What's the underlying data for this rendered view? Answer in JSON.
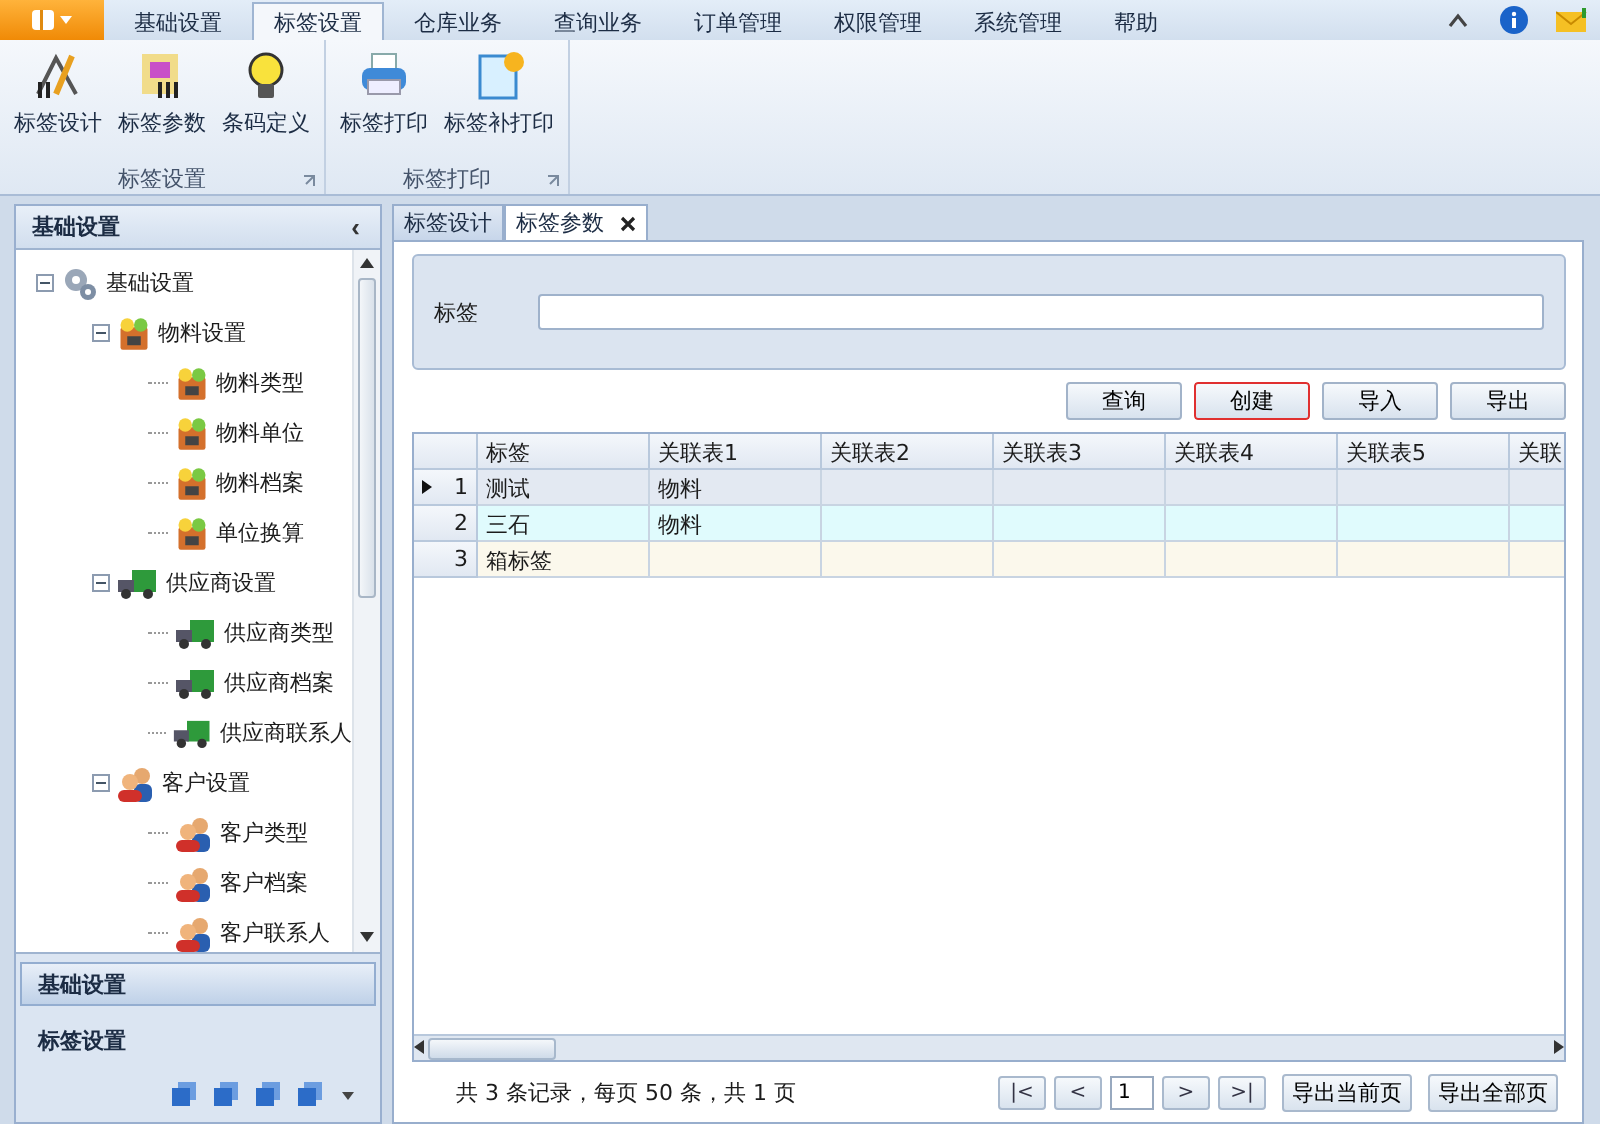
{
  "app_menu": {
    "expanded": false
  },
  "menu_tabs": [
    {
      "label": "基础设置",
      "selected": false
    },
    {
      "label": "标签设置",
      "selected": true
    },
    {
      "label": "仓库业务",
      "selected": false
    },
    {
      "label": "查询业务",
      "selected": false
    },
    {
      "label": "订单管理",
      "selected": false
    },
    {
      "label": "权限管理",
      "selected": false
    },
    {
      "label": "系统管理",
      "selected": false
    },
    {
      "label": "帮助",
      "selected": false
    }
  ],
  "ribbon_groups": [
    {
      "title": "标签设置",
      "buttons": [
        "标签设计",
        "标签参数",
        "条码定义"
      ]
    },
    {
      "title": "标签打印",
      "buttons": [
        "标签打印",
        "标签补打印"
      ]
    }
  ],
  "sidebar": {
    "title": "基础设置",
    "collapse_glyph": "‹",
    "tree": [
      {
        "label": "基础设置",
        "expanded": true,
        "children": [
          {
            "label": "物料设置",
            "expanded": true,
            "children": [
              {
                "label": "物料类型"
              },
              {
                "label": "物料单位"
              },
              {
                "label": "物料档案"
              },
              {
                "label": "单位换算"
              }
            ]
          },
          {
            "label": "供应商设置",
            "expanded": true,
            "children": [
              {
                "label": "供应商类型"
              },
              {
                "label": "供应商档案"
              },
              {
                "label": "供应商联系人"
              }
            ]
          },
          {
            "label": "客户设置",
            "expanded": true,
            "children": [
              {
                "label": "客户类型"
              },
              {
                "label": "客户档案"
              },
              {
                "label": "客户联系人"
              }
            ]
          }
        ]
      }
    ],
    "nav_sections": [
      {
        "label": "基础设置",
        "selected": true
      },
      {
        "label": "标签设置",
        "selected": false
      }
    ]
  },
  "doc_tabs": [
    {
      "label": "标签设计",
      "selected": false,
      "closable": false
    },
    {
      "label": "标签参数",
      "selected": true,
      "closable": true
    }
  ],
  "filter": {
    "label": "标签"
  },
  "actions": [
    {
      "label": "查询",
      "highlighted": false
    },
    {
      "label": "创建",
      "highlighted": true
    },
    {
      "label": "导入",
      "highlighted": false
    },
    {
      "label": "导出",
      "highlighted": false
    }
  ],
  "table": {
    "columns": [
      "标签",
      "关联表1",
      "关联表2",
      "关联表3",
      "关联表4",
      "关联表5",
      "关联"
    ],
    "rows": [
      {
        "number": "1",
        "selected": true,
        "cells": [
          "测试",
          "物料",
          "",
          "",
          "",
          "",
          ""
        ]
      },
      {
        "number": "2",
        "selected": false,
        "cells": [
          "三石",
          "物料",
          "",
          "",
          "",
          "",
          ""
        ]
      },
      {
        "number": "3",
        "selected": false,
        "cells": [
          "箱标签",
          "",
          "",
          "",
          "",
          "",
          ""
        ]
      }
    ]
  },
  "pager": {
    "summary": "共 3 条记录，每页 50 条，共 1 页",
    "first": "|<",
    "prev": "<",
    "page": "1",
    "next": ">",
    "last": ">|",
    "buttons": [
      "导出当前页",
      "导出全部页"
    ]
  }
}
